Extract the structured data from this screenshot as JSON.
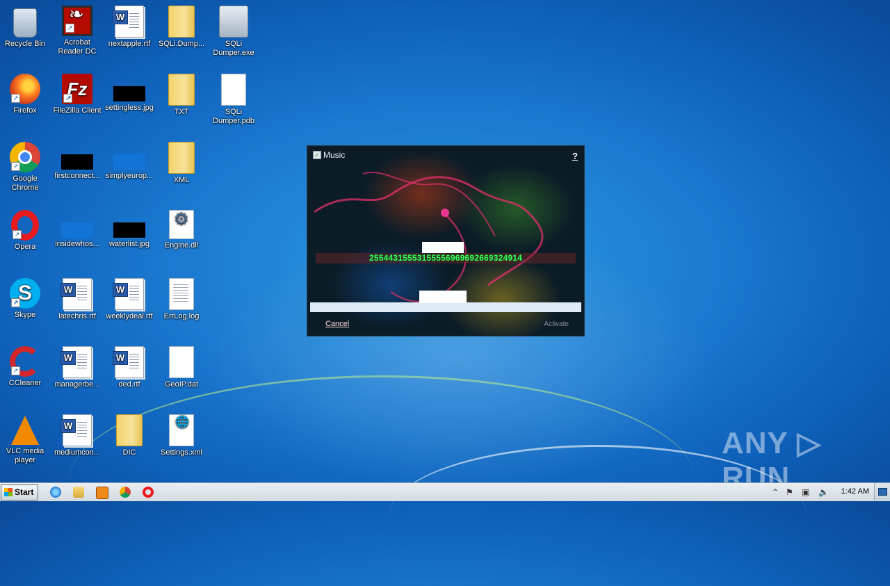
{
  "desktop": {
    "icons": [
      {
        "label": "Recycle Bin",
        "icon": "recycle-bin-icon"
      },
      {
        "label": "Acrobat Reader DC",
        "icon": "acrobat-icon"
      },
      {
        "label": "nextapple.rtf",
        "icon": "word-document-icon"
      },
      {
        "label": "SQLi.Dump...",
        "icon": "folder-icon"
      },
      {
        "label": "SQLi Dumper.exe",
        "icon": "executable-icon"
      },
      {
        "label": "Firefox",
        "icon": "firefox-icon"
      },
      {
        "label": "FileZilla Client",
        "icon": "filezilla-icon"
      },
      {
        "label": "settingless.jpg",
        "icon": "image-file-icon"
      },
      {
        "label": "TXT",
        "icon": "folder-icon"
      },
      {
        "label": "SQLi Dumper.pdb",
        "icon": "blank-file-icon"
      },
      {
        "label": "Google Chrome",
        "icon": "chrome-icon"
      },
      {
        "label": "firstconnect...",
        "icon": "image-file-icon"
      },
      {
        "label": "simplyeurop...",
        "icon": "image-file-icon"
      },
      {
        "label": "XML",
        "icon": "folder-icon"
      },
      {
        "label": "Opera",
        "icon": "opera-icon"
      },
      {
        "label": "insidewhos...",
        "icon": "image-file-icon"
      },
      {
        "label": "waterlist.jpg",
        "icon": "image-file-icon"
      },
      {
        "label": "Engine.dll",
        "icon": "dll-file-icon"
      },
      {
        "label": "Skype",
        "icon": "skype-icon"
      },
      {
        "label": "latechris.rtf",
        "icon": "word-document-icon"
      },
      {
        "label": "weeklydeal.rtf",
        "icon": "word-document-icon"
      },
      {
        "label": "ErrLog.log",
        "icon": "log-file-icon"
      },
      {
        "label": "CCleaner",
        "icon": "ccleaner-icon"
      },
      {
        "label": "managerbe...",
        "icon": "word-document-icon"
      },
      {
        "label": "ded.rtf",
        "icon": "word-document-icon"
      },
      {
        "label": "GeoIP.dat",
        "icon": "blank-file-icon"
      },
      {
        "label": "VLC media player",
        "icon": "vlc-icon"
      },
      {
        "label": "mediumcon...",
        "icon": "word-document-icon"
      },
      {
        "label": "DIC",
        "icon": "folder-icon"
      },
      {
        "label": "Settings.xml",
        "icon": "xml-file-icon"
      }
    ]
  },
  "dialog": {
    "title": "Music",
    "help": "?",
    "code": "25544315553155556969692669324914",
    "cancel": "Cancel",
    "activate": "Activate"
  },
  "taskbar": {
    "start": "Start",
    "clock": "1:42 AM",
    "tray_chevron": "⌃"
  },
  "watermark": "ANY ▷ RUN",
  "colors": {
    "code_green": "#39ff5a",
    "desktop_blue": "#1a78cf"
  }
}
